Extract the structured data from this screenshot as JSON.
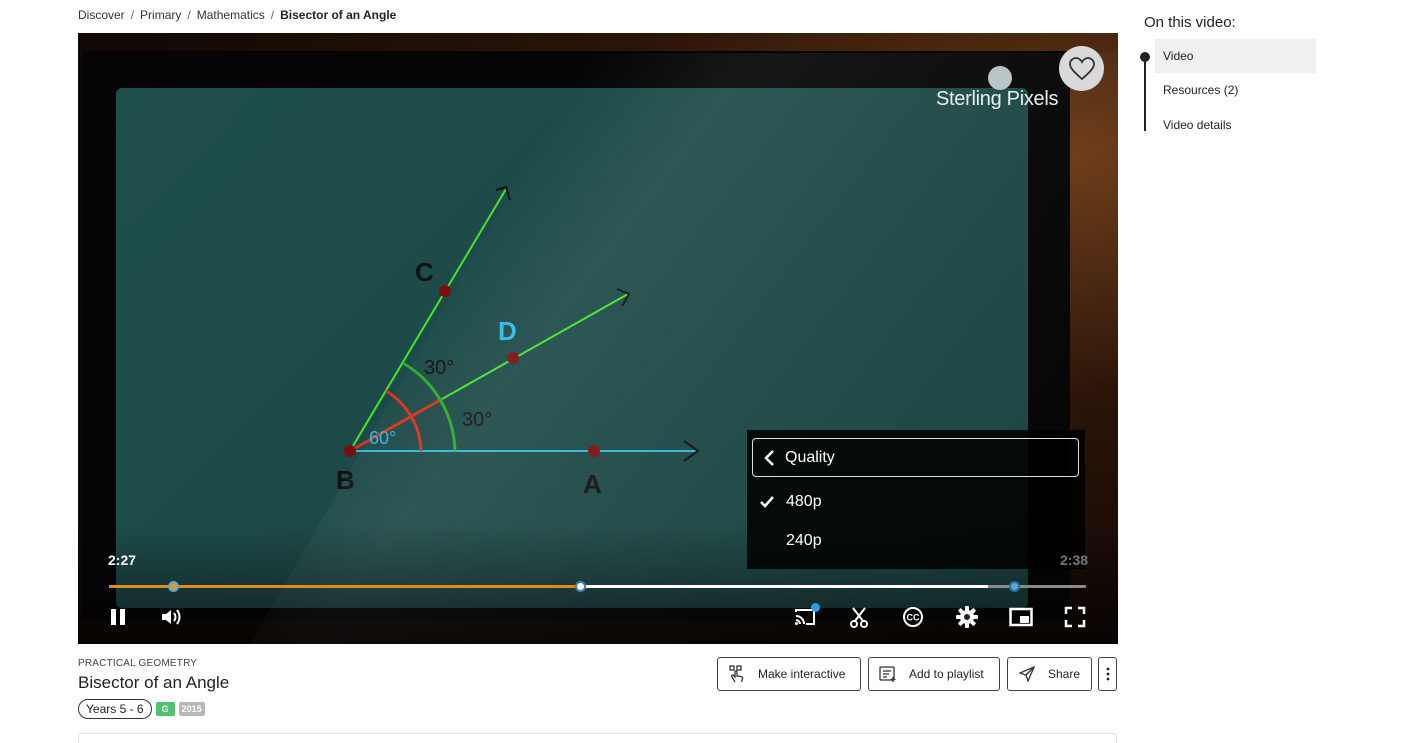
{
  "breadcrumb": {
    "items": [
      "Discover",
      "Primary",
      "Mathematics"
    ],
    "current": "Bisector of an Angle",
    "separator": "/"
  },
  "video": {
    "brand": "Sterling Pixels",
    "labels": {
      "c": "C",
      "d": "D",
      "b": "B",
      "a": "A",
      "angle_top": "30°",
      "angle_bottom": "30°",
      "angle_whole": "60°"
    },
    "current_time": "2:27",
    "total_time": "2:38",
    "progress": {
      "played_fraction": 0.483,
      "buffered_fraction": 0.9,
      "marker_fraction": 0.067,
      "end_marker_fraction": 0.927
    },
    "controls": {
      "pause": "pause-icon",
      "volume": "volume-icon",
      "cast": "cast-icon",
      "clip": "scissors-icon",
      "captions": "cc-icon",
      "settings": "gear-icon",
      "pip": "picture-in-picture-icon",
      "fullscreen": "fullscreen-icon"
    },
    "quality_menu": {
      "title": "Quality",
      "options": [
        {
          "label": "480p",
          "selected": true
        },
        {
          "label": "240p",
          "selected": false
        }
      ]
    }
  },
  "details": {
    "category": "PRACTICAL GEOMETRY",
    "title": "Bisector of an Angle",
    "years": "Years 5 - 6",
    "rating": "G",
    "year": "2015"
  },
  "actions": {
    "make_interactive": "Make interactive",
    "add_to_playlist": "Add to playlist",
    "share": "Share"
  },
  "sidebar": {
    "title": "On this video:",
    "items": [
      {
        "label": "Video",
        "active": true
      },
      {
        "label": "Resources (2)",
        "active": false
      },
      {
        "label": "Video details",
        "active": false
      }
    ]
  },
  "colors": {
    "accent_orange": "#e38b1a",
    "cast_badge": "#2e9be8",
    "board": "#1f4f4d",
    "rating_green": "#4fc26f"
  }
}
